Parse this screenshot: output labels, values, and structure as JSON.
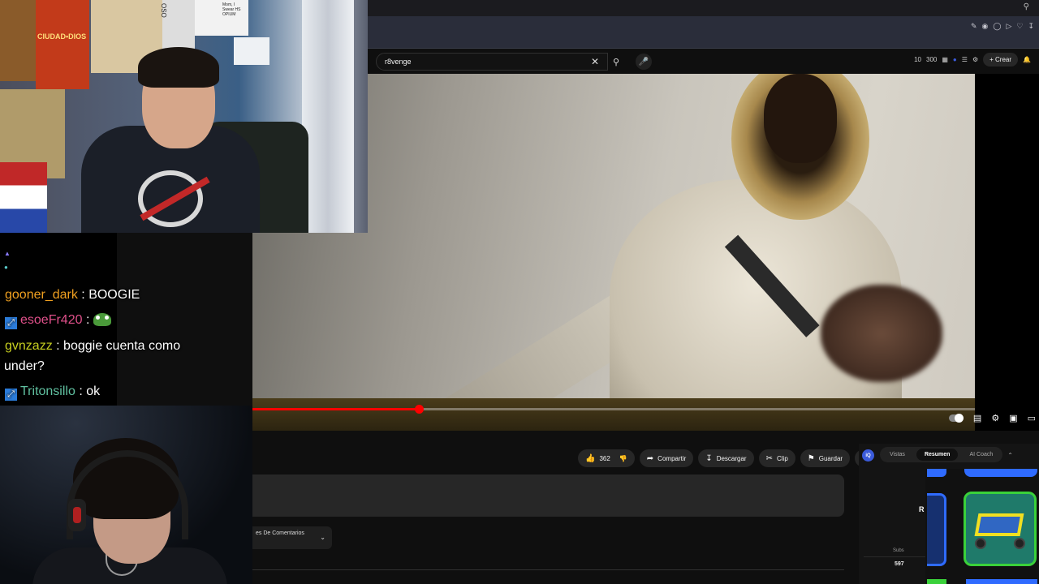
{
  "browser": {
    "top_search_icon": "search-icon",
    "extension_icons": [
      "edit-icon",
      "camera-icon",
      "shield-icon",
      "play-icon",
      "heart-icon",
      "download-icon"
    ]
  },
  "youtube": {
    "search": {
      "value": "r8venge"
    },
    "header_right": {
      "stat1": "10",
      "stat2": "300",
      "create_label": "Crear"
    },
    "video": {
      "progress": 0.23
    },
    "actions": {
      "likes": "362",
      "share": "Compartir",
      "download": "Descargar",
      "clip": "Clip",
      "save": "Guardar"
    },
    "comments_sort": "es De Comentarios"
  },
  "extension": {
    "tabs": [
      "Vistas",
      "Resumen",
      "AI Coach"
    ],
    "active_tab": "Resumen",
    "side_label": "R",
    "subs_label": "Subs",
    "subs_value": "597"
  },
  "webcam": {
    "poster_ciudad": "CIUDAD•DIOS",
    "poster_side": "OSO",
    "poster_note": "Mom, I Swear HS OPIUM"
  },
  "chat": {
    "messages": [
      {
        "user": "gooner_dark",
        "color": "#f0a020",
        "badge": false,
        "text": "BOOGIE"
      },
      {
        "user": "esoeFr420",
        "color": "#e0508a",
        "badge": true,
        "text": "",
        "emote": "frog"
      },
      {
        "user": "gvnzazz",
        "color": "#c8d020",
        "badge": false,
        "text": "boggie cuenta como",
        "text2": "under?"
      },
      {
        "user": "Tritonsillo",
        "color": "#60c0a0",
        "badge": true,
        "text": "ok"
      }
    ]
  },
  "colors": {
    "youtube_red": "#ff0000",
    "accent_blue": "#2f6bff",
    "accent_green": "#3ad13a"
  }
}
